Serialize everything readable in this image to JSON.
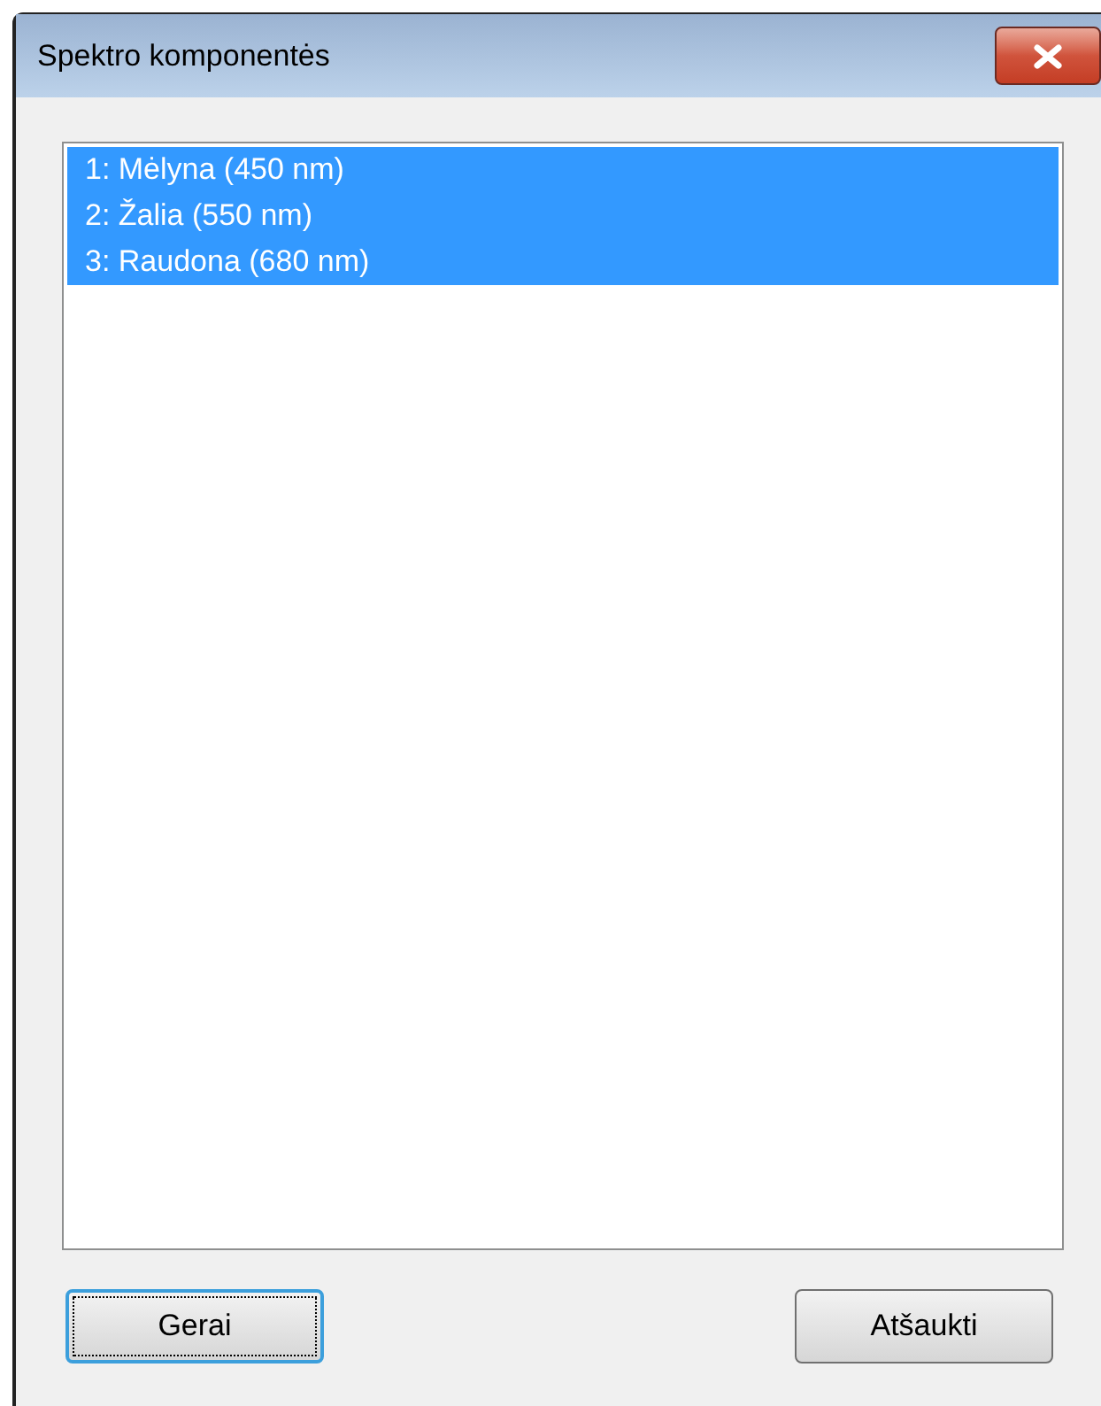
{
  "window": {
    "title": "Spektro komponentės"
  },
  "list": {
    "items": [
      {
        "label": "1: Mėlyna (450 nm)",
        "selected": true
      },
      {
        "label": "2: Žalia (550 nm)",
        "selected": true
      },
      {
        "label": "3: Raudona (680 nm)",
        "selected": true
      }
    ]
  },
  "buttons": [
    {
      "label": "Gerai",
      "focused": true
    },
    {
      "label": "Atšaukti",
      "focused": false
    }
  ]
}
